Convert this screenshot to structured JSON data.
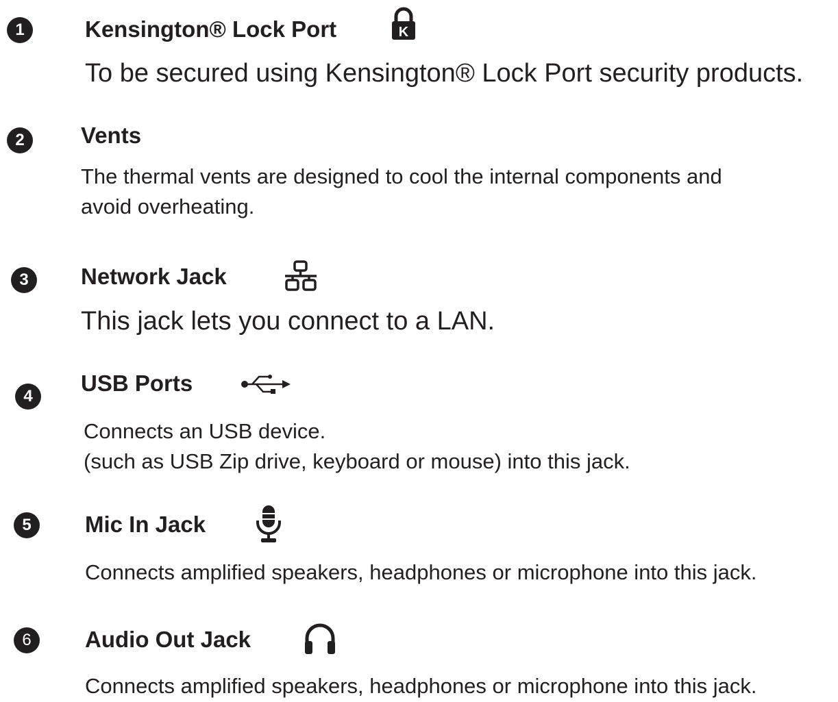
{
  "items": [
    {
      "number": "1",
      "title": "Kensington® Lock Port",
      "icon": "kensington-lock-icon",
      "lines": [
        "To be secured using Kensington® Lock Port security products."
      ]
    },
    {
      "number": "2",
      "title": "Vents",
      "icon": "",
      "lines": [
        "The thermal vents are designed to cool the internal components and",
        "avoid overheating."
      ]
    },
    {
      "number": "3",
      "title": "Network Jack",
      "icon": "network-icon",
      "lines": [
        "This jack lets you connect to a LAN."
      ]
    },
    {
      "number": "4",
      "title": "USB Ports",
      "icon": "usb-icon",
      "lines": [
        "Connects an USB device.",
        "(such as USB Zip drive, keyboard or mouse) into this jack."
      ]
    },
    {
      "number": "5",
      "title": "Mic In Jack",
      "icon": "microphone-icon",
      "lines": [
        "Connects amplified speakers, headphones or microphone into this jack."
      ]
    },
    {
      "number": "6",
      "title": "Audio Out Jack",
      "icon": "headphones-icon",
      "lines": [
        "Connects amplified speakers, headphones or microphone into this jack."
      ]
    }
  ],
  "colors": {
    "text": "#231f20",
    "badge": "#231f20",
    "badge_text": "#ffffff",
    "background": "#ffffff"
  }
}
